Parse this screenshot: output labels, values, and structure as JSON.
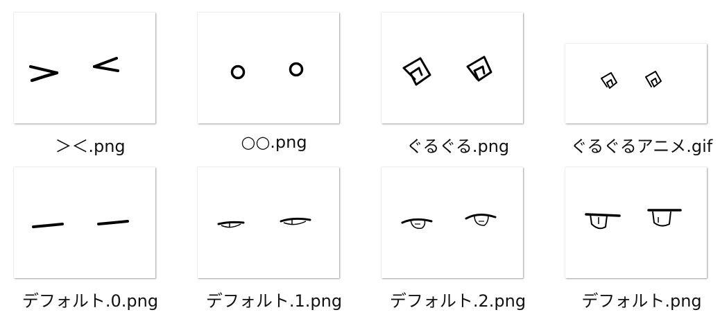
{
  "files": [
    {
      "name": "＞＜.png",
      "icon": "eyes-closed-squint-thumbnail"
    },
    {
      "name": "○○.png",
      "icon": "eyes-circle-thumbnail"
    },
    {
      "name": "ぐるぐる.png",
      "icon": "eyes-spiral-thumbnail"
    },
    {
      "name": "ぐるぐるアニメ.gif",
      "icon": "eyes-spiral-animated-thumbnail"
    },
    {
      "name": "デフォルト.0.png",
      "icon": "eyes-closed-thumbnail"
    },
    {
      "name": "デフォルト.1.png",
      "icon": "eyes-half-open-thumbnail"
    },
    {
      "name": "デフォルト.2.png",
      "icon": "eyes-mostly-open-thumbnail"
    },
    {
      "name": "デフォルト.png",
      "icon": "eyes-open-thumbnail"
    }
  ]
}
